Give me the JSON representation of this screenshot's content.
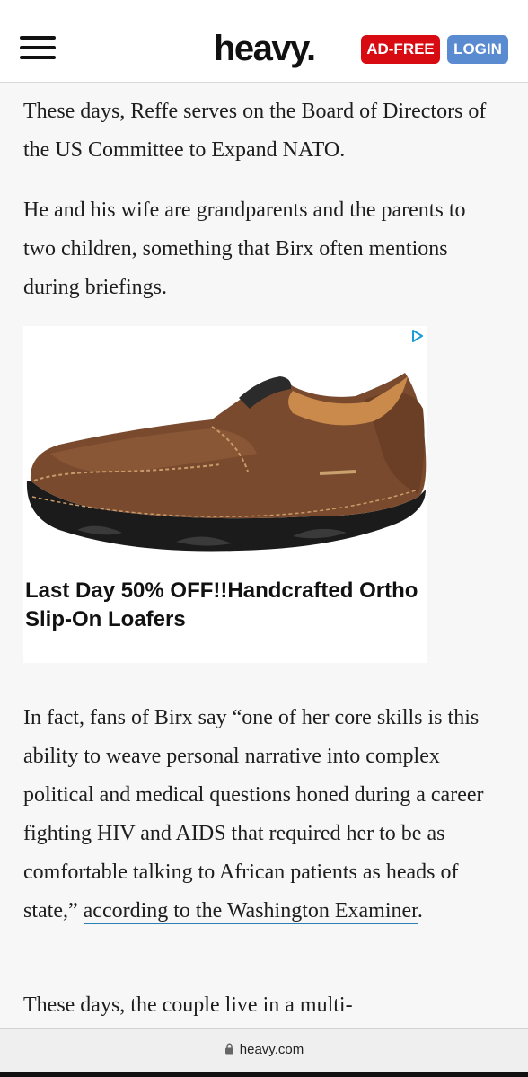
{
  "header": {
    "logo": "heavy.",
    "ad_free_label": "AD-FREE",
    "login_label": "LOGIN",
    "menu_icon": "hamburger-menu-icon"
  },
  "article": {
    "paragraph_1": "These days, Reffe serves on the Board of Directors of the US Committee to Expand NATO.",
    "paragraph_2": "He and his wife are grandparents and the parents to two children, something that Birx often mentions during briefings.",
    "paragraph_3_text": "In fact, fans of Birx say “one of her core skills is this ability to weave personal narrative into complex political and medical questions honed during a career fighting HIV and AIDS that required her to be as comfortable talking to African patients as heads of state,” ",
    "paragraph_3_link": "according to the Washington Examiner",
    "paragraph_3_end": ".",
    "paragraph_4": "These days, the couple live in a multi-"
  },
  "ad": {
    "headline": "Last Day 50% OFF!!Handcrafted Ortho Slip-On Loafers",
    "choices_icon": "ad-choices-icon",
    "image": "brown-leather-loafer-shoe"
  },
  "browser": {
    "url": "heavy.com",
    "lock_icon": "lock-icon"
  },
  "colors": {
    "ad_free": "#d90b12",
    "login": "#5a8bd1",
    "link_underline": "#2a7fb5",
    "shoe_leather": "#7a4a2e"
  }
}
